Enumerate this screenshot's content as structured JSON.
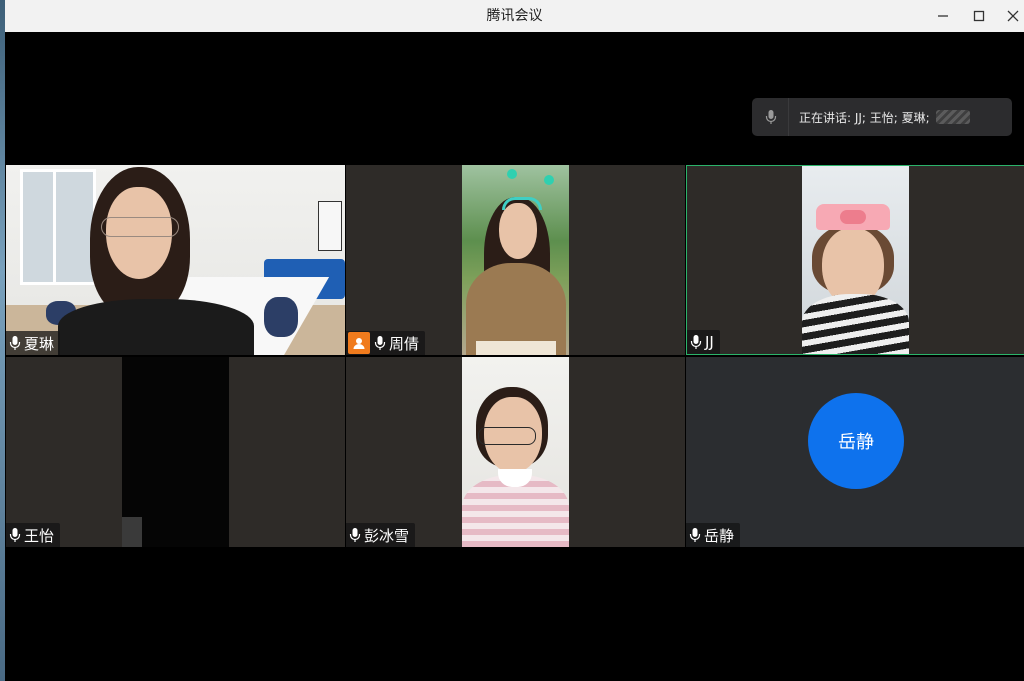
{
  "window": {
    "title": "腾讯会议",
    "controls": [
      "minimize-icon",
      "maximize-icon",
      "close-icon"
    ]
  },
  "speaking": {
    "label": "正在讲话: JJ; 王怡; 夏琳;"
  },
  "participants": [
    {
      "name": "夏琳",
      "host": false,
      "video": true
    },
    {
      "name": "周倩",
      "host": true,
      "video": true
    },
    {
      "name": "JJ",
      "host": false,
      "video": true,
      "active": true
    },
    {
      "name": "王怡",
      "host": false,
      "video": true
    },
    {
      "name": "彭冰雪",
      "host": false,
      "video": true
    },
    {
      "name": "岳静",
      "host": false,
      "video": false,
      "avatar_text": "岳静"
    }
  ],
  "colors": {
    "tile_bg": "#2e2b28",
    "active_border": "#2bb36a",
    "avatar_blue": "#0e72ed",
    "host_badge": "#f07b1d"
  }
}
